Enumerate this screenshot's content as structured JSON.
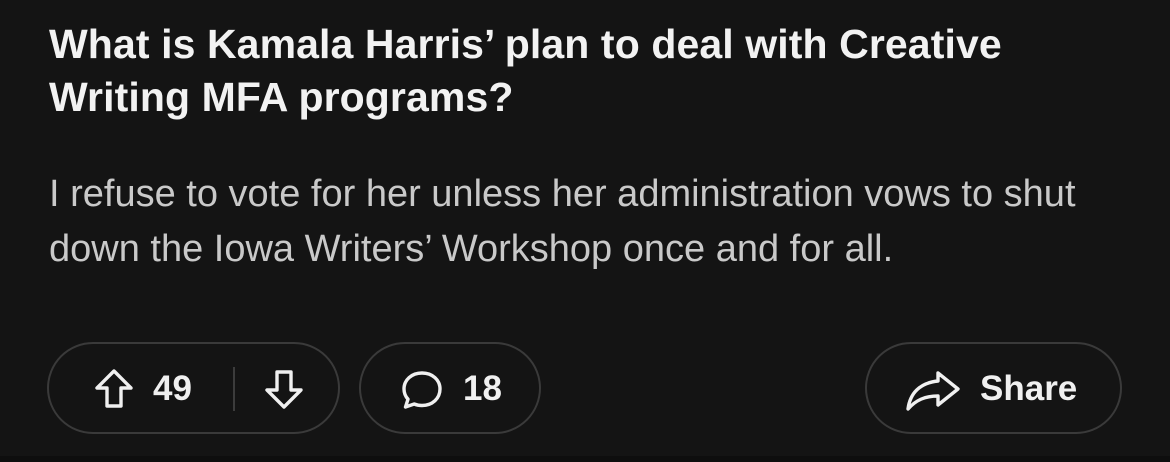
{
  "post": {
    "title": "What is Kamala Harris’ plan to deal with Creative Writing MFA programs?",
    "body": "I refuse to vote for her unless her administration vows to shut down the Iowa Writers’ Workshop once and for all."
  },
  "actions": {
    "vote_count": "49",
    "comment_count": "18",
    "share_label": "Share",
    "upvote_icon": "arrow-up-outline-icon",
    "downvote_icon": "arrow-down-outline-icon",
    "comment_icon": "speech-bubble-icon",
    "share_icon": "share-arrow-icon"
  },
  "colors": {
    "background": "#141414",
    "title": "#f2f2f2",
    "body": "#c9c9c9",
    "pill_border": "#3a3a3a"
  }
}
